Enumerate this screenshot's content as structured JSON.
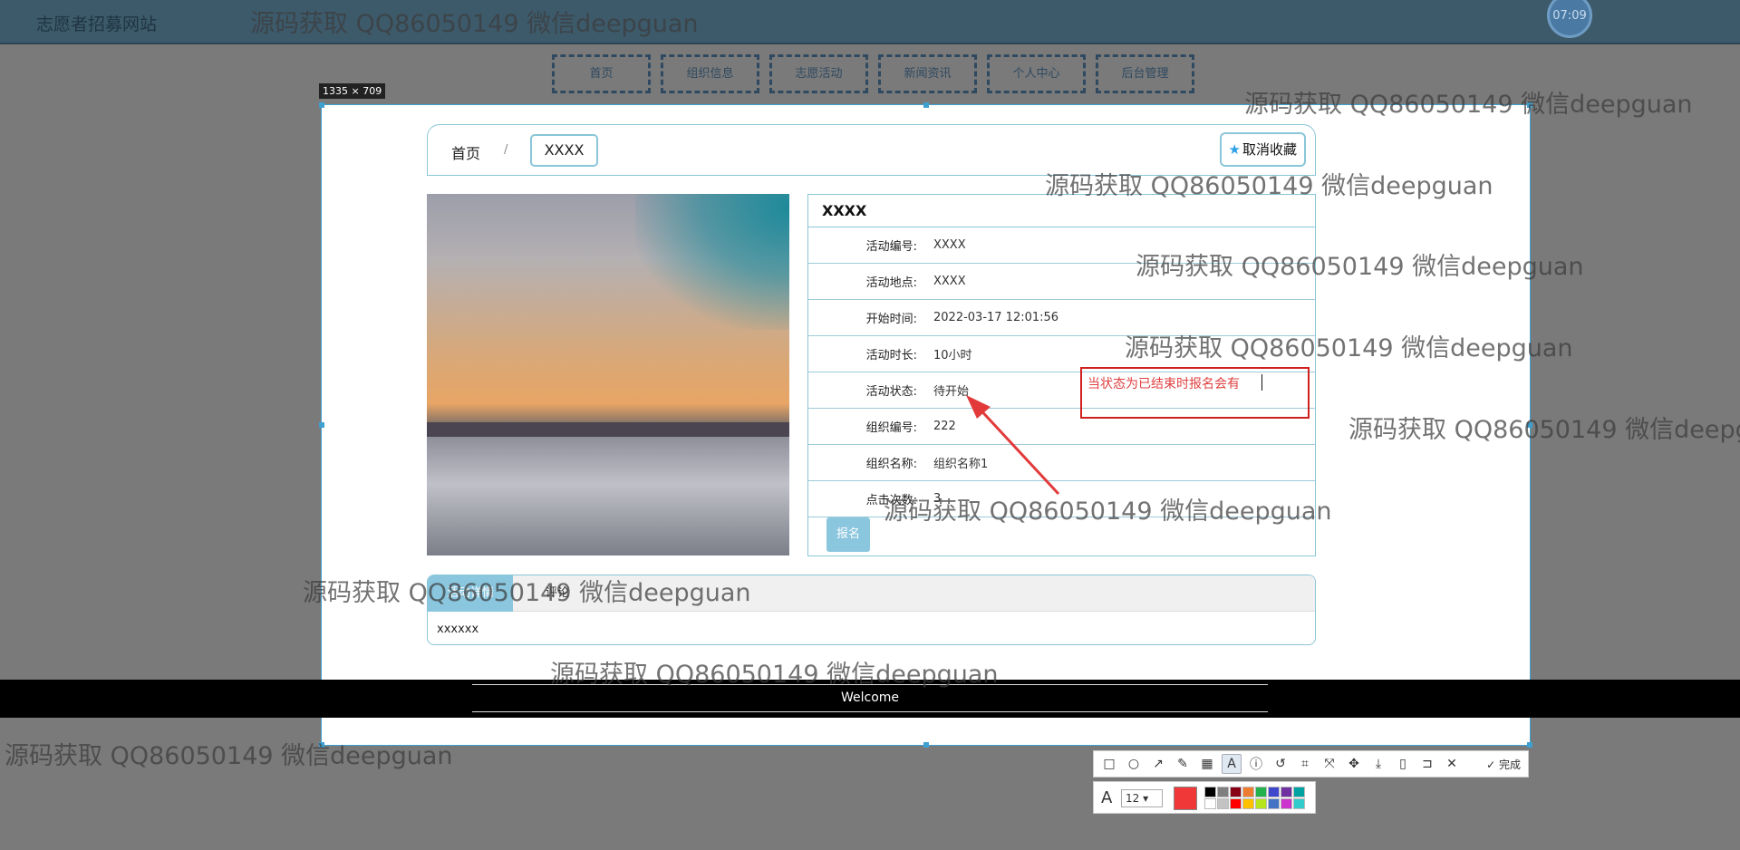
{
  "header": {
    "site_title": "志愿者招募网站",
    "clock": "07:09"
  },
  "nav": {
    "items": [
      "首页",
      "组织信息",
      "志愿活动",
      "新闻资讯",
      "个人中心",
      "后台管理"
    ]
  },
  "selection": {
    "dimensions": "1335 × 709"
  },
  "breadcrumb": {
    "home": "首页",
    "separator": "/",
    "current": "XXXX",
    "favorite_label": "取消收藏"
  },
  "detail": {
    "title": "XXXX",
    "fields": [
      {
        "label": "活动编号:",
        "value": "XXXX"
      },
      {
        "label": "活动地点:",
        "value": "XXXX"
      },
      {
        "label": "开始时间:",
        "value": "2022-03-17 12:01:56"
      },
      {
        "label": "活动时长:",
        "value": "10小时"
      },
      {
        "label": "活动状态:",
        "value": "待开始"
      },
      {
        "label": "组织编号:",
        "value": "222"
      },
      {
        "label": "组织名称:",
        "value": "组织名称1"
      },
      {
        "label": "点击次数:",
        "value": "3"
      }
    ],
    "signup_label": "报名"
  },
  "tabs": {
    "items": [
      "活动详情",
      "评论"
    ],
    "content": "xxxxxx"
  },
  "footer": {
    "text": "Welcome"
  },
  "annotation": {
    "text": "当状态为已结束时报名会有",
    "color": "#d0201e"
  },
  "watermark": {
    "text": "源码获取 QQ86050149 微信deepguan"
  },
  "toolbar": {
    "tools": [
      "rectangle-icon",
      "ellipse-icon",
      "arrow-icon",
      "pen-icon",
      "mosaic-icon",
      "text-icon",
      "serial-number-icon",
      "undo-icon",
      "ocr-icon",
      "scroll-capture-icon",
      "pin-icon",
      "download-icon",
      "save-icon",
      "bookmark-icon",
      "close-icon"
    ],
    "done_label": "完成",
    "font_size": "12",
    "current_color": "#f03838",
    "palette": [
      "#000000",
      "#7f7f7f",
      "#880015",
      "#ed7d31",
      "#22b14c",
      "#3f48cc",
      "#7030a0",
      "#00a2a2",
      "#ffffff",
      "#c3c3c3",
      "#ff0000",
      "#ffc000",
      "#b5e61d",
      "#4472c4",
      "#cc33cc",
      "#33cccc"
    ]
  }
}
